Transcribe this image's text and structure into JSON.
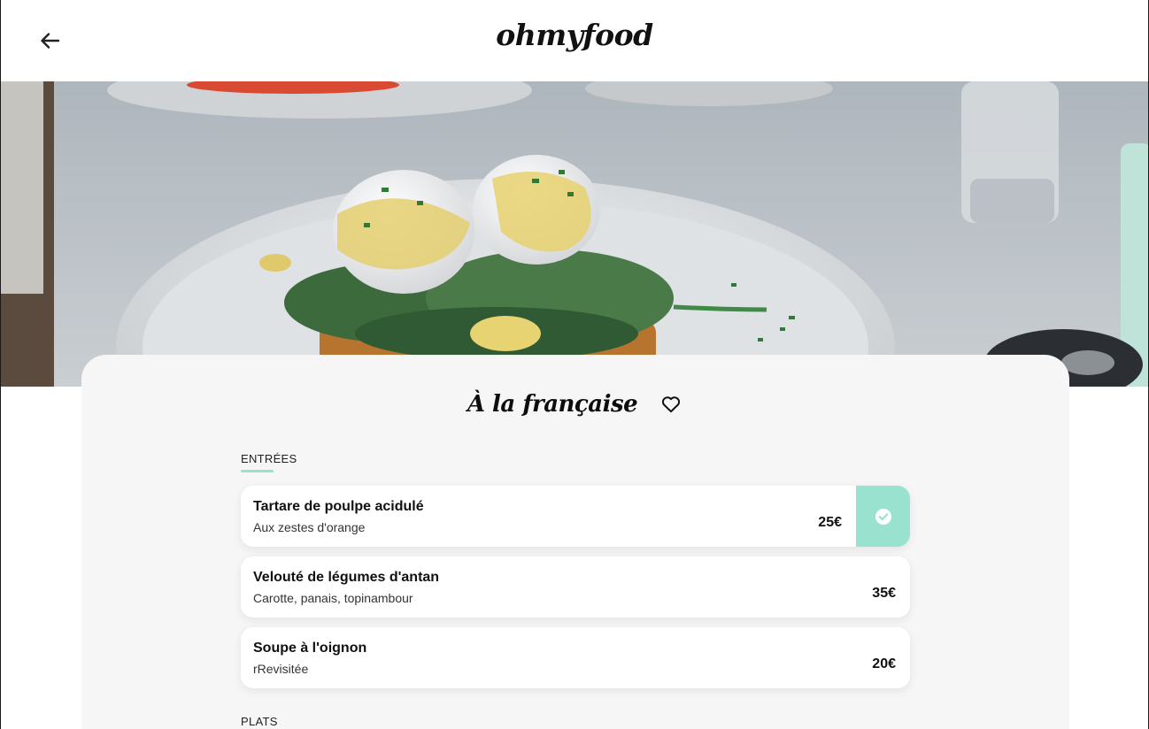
{
  "header": {
    "logo": "ohmyfood",
    "back_icon": "arrow-left-icon"
  },
  "restaurant": {
    "title": "À la française",
    "favorite_icon": "heart-outline-icon"
  },
  "sections": [
    {
      "label": "ENTRÉES",
      "dishes": [
        {
          "name": "Tartare de poulpe acidulé",
          "description": "Aux zestes d'orange",
          "price": "25€",
          "selected": true
        },
        {
          "name": "Velouté de légumes d'antan",
          "description": "Carotte, panais, topinambour",
          "price": "35€",
          "selected": false
        },
        {
          "name": "Soupe à l'oignon",
          "description": "rRevisitée",
          "price": "20€",
          "selected": false
        }
      ]
    },
    {
      "label": "PLATS",
      "dishes": []
    }
  ],
  "colors": {
    "accent": "#99e2d0",
    "card_background": "#f6f6f6",
    "text": "#111111"
  }
}
